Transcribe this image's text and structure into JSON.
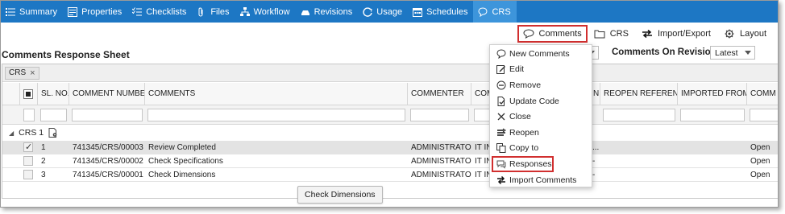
{
  "nav": {
    "items": [
      {
        "label": "Summary",
        "icon": "list-icon"
      },
      {
        "label": "Properties",
        "icon": "properties-icon"
      },
      {
        "label": "Checklists",
        "icon": "checklist-icon"
      },
      {
        "label": "Files",
        "icon": "paperclip-icon"
      },
      {
        "label": "Workflow",
        "icon": "workflow-icon"
      },
      {
        "label": "Revisions",
        "icon": "revisions-icon"
      },
      {
        "label": "Usage",
        "icon": "usage-icon"
      },
      {
        "label": "Schedules",
        "icon": "calendar-icon"
      },
      {
        "label": "CRS",
        "icon": "comment-icon",
        "active": true
      }
    ]
  },
  "toolbar": {
    "comments_label": "Comments",
    "crs_label": "CRS",
    "import_export_label": "Import/Export",
    "layout_label": "Layout"
  },
  "sheet": {
    "title": "Comments Response Sheet",
    "revisions_label": "Comments On Revisions:",
    "revisions_value": "Latest"
  },
  "grid": {
    "group_chip": "CRS",
    "group_chip_close": "×",
    "columns": [
      "SL. NO.",
      "COMMENT NUMBER",
      "COMMENTS",
      "COMMENTER",
      "COM",
      "N",
      "REOPEN REFERENCE...",
      "IMPORTED FROM",
      "COMM"
    ],
    "group_row": "CRS 1",
    "rows": [
      {
        "sl": "1",
        "number": "741345/CRS/00003",
        "comment": "Review Completed",
        "commenter": "ADMINISTRATOR",
        "com": "IT IN",
        "mid": "...",
        "comm": "Open",
        "checked": true
      },
      {
        "sl": "2",
        "number": "741345/CRS/00002",
        "comment": "Check Specifications",
        "commenter": "ADMINISTRATOR",
        "com": "IT IN",
        "mid": "-",
        "comm": "Open",
        "checked": false
      },
      {
        "sl": "3",
        "number": "741345/CRS/00001",
        "comment": "Check Dimensions",
        "commenter": "ADMINISTRATOR",
        "com": "IT INF",
        "mid": "-",
        "comm": "Open",
        "checked": false
      }
    ],
    "tooltip": "Check Dimensions"
  },
  "menu": {
    "items": [
      {
        "label": "New Comments",
        "icon": "new-comment-icon"
      },
      {
        "label": "Edit",
        "icon": "edit-icon"
      },
      {
        "label": "Remove",
        "icon": "remove-icon"
      },
      {
        "label": "Update Code",
        "icon": "update-code-icon"
      },
      {
        "label": "Close",
        "icon": "close-icon"
      },
      {
        "label": "Reopen",
        "icon": "reopen-icon"
      },
      {
        "label": "Copy to",
        "icon": "copy-icon"
      },
      {
        "label": "Responses",
        "icon": "responses-icon",
        "highlight": true
      },
      {
        "label": "Import Comments",
        "icon": "import-icon"
      }
    ]
  },
  "colors": {
    "nav_bg": "#1d77c4",
    "nav_active": "#3d95db",
    "highlight_border": "#d12f2f"
  }
}
